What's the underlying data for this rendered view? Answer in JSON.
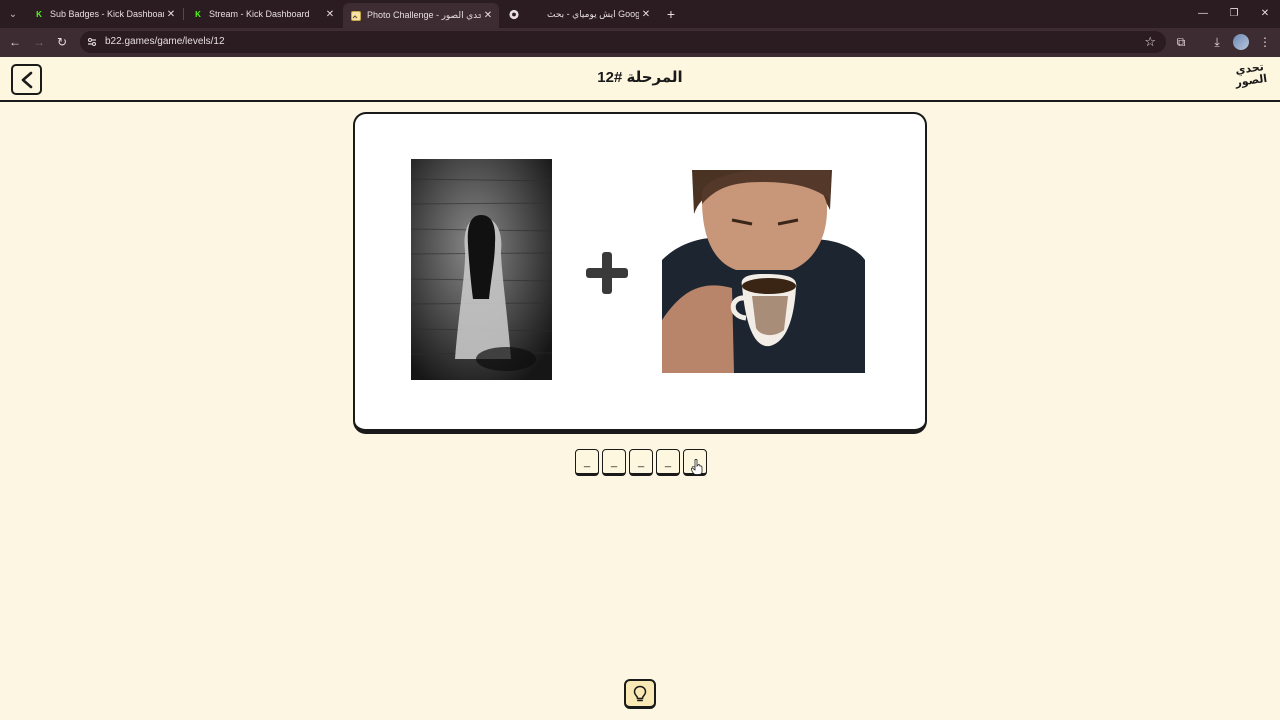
{
  "browser": {
    "tabs": [
      {
        "title": "Sub Badges - Kick Dashboard",
        "favicon": "kick-icon",
        "active": false
      },
      {
        "title": "Stream - Kick Dashboard",
        "favicon": "kick-icon",
        "active": false
      },
      {
        "title": "Photo Challenge - تحدي الصور",
        "favicon": "photo-challenge-icon",
        "active": true
      },
      {
        "title": "",
        "favicon": "chrome-icon",
        "active": false
      },
      {
        "title": "ايش يومياي - بحث Google",
        "favicon": "google-icon",
        "active": false
      }
    ],
    "url": "b22.games/game/levels/12"
  },
  "header": {
    "title": "المرحلة #12",
    "logo_text": "تحدي الصور"
  },
  "puzzle": {
    "images": [
      {
        "subject": "ghost-girl-image"
      },
      {
        "subject": "man-drinking-coffee-image"
      }
    ],
    "operator_icon": "plus-icon"
  },
  "answer": {
    "slots": [
      "_",
      "_",
      "_",
      "_",
      "_"
    ]
  },
  "hint": {
    "icon": "lightbulb-icon"
  },
  "colors": {
    "page_bg": "#fdf6e3",
    "header_bg": "#fef7e0",
    "ink": "#1a1a1a",
    "chrome_dark": "#2a1c21",
    "chrome_toolbar": "#3d2c32",
    "kick_green": "#53fc18"
  }
}
